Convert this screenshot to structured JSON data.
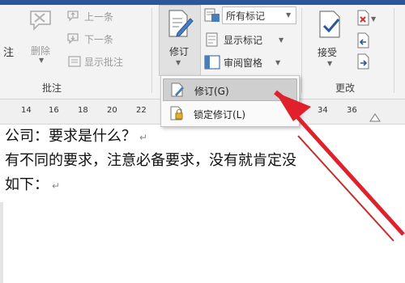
{
  "ribbon": {
    "comments_group": {
      "label": "批注",
      "new_comment_partial": "注",
      "delete_label": "删除",
      "previous_label": "上一条",
      "next_label": "下一条",
      "show_comments_label": "显示批注"
    },
    "tracking_group": {
      "track_changes_label": "修订",
      "markup_select_value": "所有标记",
      "show_markup_label": "显示标记",
      "reviewing_pane_label": "审阅窗格"
    },
    "changes_group": {
      "label": "更改",
      "accept_label": "接受"
    }
  },
  "track_menu": {
    "items": [
      {
        "label": "修订(G)"
      },
      {
        "label": "锁定修订(L)"
      }
    ]
  },
  "ruler": {
    "ticks": [
      "14",
      "16",
      "18",
      "20",
      "22",
      "34",
      "36"
    ]
  },
  "document": {
    "lines": [
      "公司：要求是什么？",
      "有不同的要求，注意必备要求，没有就肯定没",
      "如下："
    ],
    "paragraph_mark": "↵"
  },
  "colors": {
    "ribbon_bg": "#f3f3f3",
    "title_band": "#2b579a",
    "annotation_arrow": "#e0202a"
  }
}
